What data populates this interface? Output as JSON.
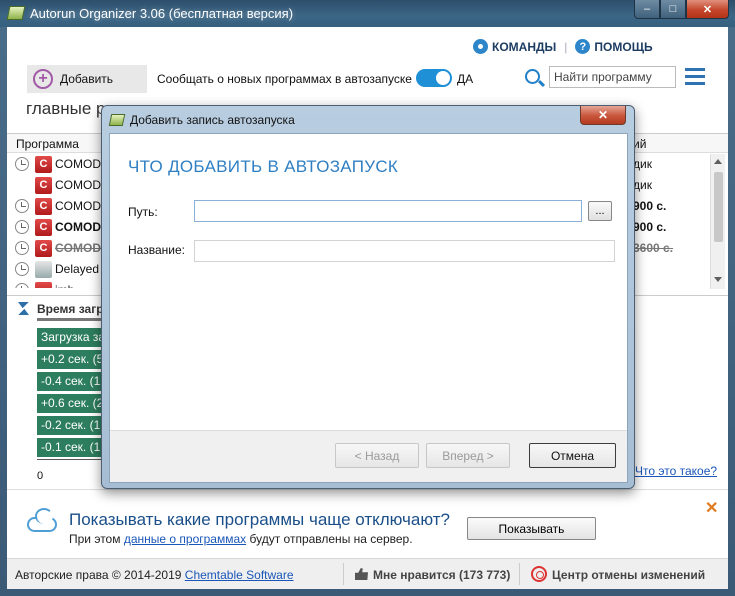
{
  "window": {
    "title": "Autorun Organizer 3.06 (бесплатная версия)",
    "minimize": "–",
    "maximize": "□",
    "close": "✕"
  },
  "header": {
    "commands_label": "КОМАНДЫ",
    "separator": "|",
    "help_label": "ПОМОЩЬ"
  },
  "toolbar": {
    "add_label": "Добавить",
    "notify_text": "Сообщать о новых программах в автозапуске",
    "toggle_value": "ДА",
    "search_placeholder": "Найти программу"
  },
  "section_tab": "главные р",
  "list": {
    "columns": {
      "program": "Программа",
      "right": "ий"
    },
    "rows": [
      {
        "name": "COMODO",
        "right": "дик",
        "style": "normal",
        "clock": true
      },
      {
        "name": "COMODO",
        "right": "дик",
        "style": "normal",
        "clock": false
      },
      {
        "name": "COMODO",
        "right": "900 с.",
        "style": "normal",
        "clock": true
      },
      {
        "name": "COMODO",
        "right": "900 с.",
        "style": "bold",
        "clock": true
      },
      {
        "name": "COMODO",
        "right": "3600 с.",
        "style": "strike",
        "clock": true
      },
      {
        "name": "Delayed",
        "right": "",
        "style": "normal",
        "clock": true
      },
      {
        "name": "imh",
        "right": "",
        "style": "normal",
        "clock": true
      }
    ]
  },
  "load_time": {
    "title": "Время загр",
    "bars": [
      "Загрузка за",
      "+0.2 сек. (5",
      "-0.4 сек. (12",
      "+0.6 сек. (2",
      "-0.2 сек. (1",
      "-0.1 сек. (1"
    ],
    "axis_zero": "0",
    "what_link": "Что это такое?"
  },
  "banner": {
    "title": "Показывать какие программы чаще отключают?",
    "text_before": "При этом ",
    "link": "данные о программах",
    "text_after": " будут отправлены на сервер.",
    "show_button": "Показывать",
    "close": "✕"
  },
  "footer": {
    "copyright": "Авторские права © 2014-2019 ",
    "company": "Chemtable Software",
    "likes": "Мне нравится (173 773)",
    "undo_center": "Центр отмены изменений"
  },
  "dialog": {
    "title": "Добавить запись автозапуска",
    "close": "✕",
    "heading": "ЧТО ДОБАВИТЬ В АВТОЗАПУСК",
    "path_label": "Путь:",
    "browse_label": "...",
    "name_label": "Название:",
    "back_label": "< Назад",
    "next_label": "Вперед >",
    "cancel_label": "Отмена"
  }
}
